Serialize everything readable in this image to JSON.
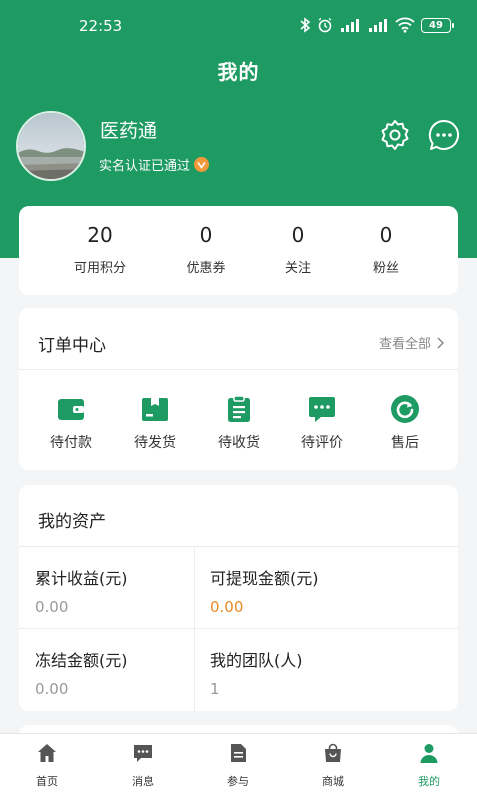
{
  "status_bar": {
    "time": "22:53",
    "battery": "49"
  },
  "header": {
    "title": "我的"
  },
  "profile": {
    "name": "医药通",
    "verify_text": "实名认证已通过"
  },
  "stats": [
    {
      "value": "20",
      "label": "可用积分"
    },
    {
      "value": "0",
      "label": "优惠券"
    },
    {
      "value": "0",
      "label": "关注"
    },
    {
      "value": "0",
      "label": "粉丝"
    }
  ],
  "orders": {
    "title": "订单中心",
    "view_all": "查看全部",
    "items": [
      {
        "label": "待付款",
        "icon": "wallet-icon"
      },
      {
        "label": "待发货",
        "icon": "box-icon"
      },
      {
        "label": "待收货",
        "icon": "clipboard-icon"
      },
      {
        "label": "待评价",
        "icon": "comment-icon"
      },
      {
        "label": "售后",
        "icon": "refresh-icon"
      }
    ]
  },
  "assets": {
    "title": "我的资产",
    "items": [
      {
        "label": "累计收益(元)",
        "value": "0.00"
      },
      {
        "label": "可提现金额(元)",
        "value": "0.00"
      },
      {
        "label": "冻结金额(元)",
        "value": "0.00"
      },
      {
        "label": "我的团队(人)",
        "value": "1"
      }
    ]
  },
  "tabs": [
    {
      "label": "首页",
      "icon": "home-icon"
    },
    {
      "label": "消息",
      "icon": "message-icon"
    },
    {
      "label": "参与",
      "icon": "document-icon"
    },
    {
      "label": "商城",
      "icon": "shopping-bag-icon"
    },
    {
      "label": "我的",
      "icon": "user-icon"
    }
  ],
  "colors": {
    "brand_green": "#1e9a63",
    "accent_orange": "#e88a28",
    "badge_orange": "#f29a3a"
  }
}
